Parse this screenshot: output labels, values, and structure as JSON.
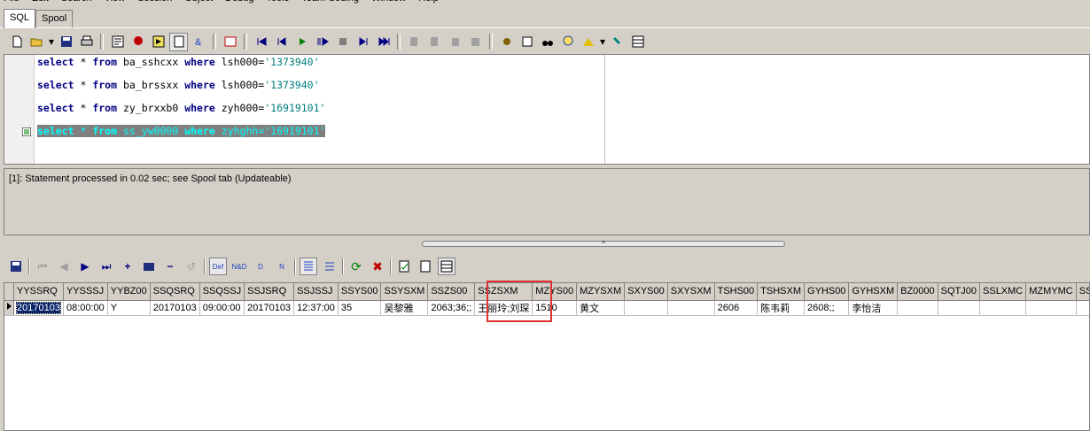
{
  "menubar": {
    "items": [
      "File",
      "Edit",
      "Search",
      "View",
      "Session",
      "Object",
      "Debug",
      "Tools",
      "Team Coding",
      "Window",
      "Help"
    ]
  },
  "tabs": [
    {
      "label": "SQL"
    },
    {
      "label": "Spool"
    }
  ],
  "editor": {
    "lines": [
      {
        "kw1": "select",
        "rest1": " * ",
        "kw2": "from",
        "table": " ba_sshcxx ",
        "kw3": "where",
        "cond": " lsh000=",
        "str": "'1373940'"
      },
      {
        "kw1": "select",
        "rest1": " * ",
        "kw2": "from",
        "table": " ba_brssxx ",
        "kw3": "where",
        "cond": " lsh000=",
        "str": "'1373940'"
      },
      {
        "kw1": "select",
        "rest1": " * ",
        "kw2": "from",
        "table": " zy_brxxb0 ",
        "kw3": "where",
        "cond": " zyh000=",
        "str": "'16919101'"
      },
      {
        "kw1": "select",
        "rest1": " * ",
        "kw2": "from",
        "table": " ss_yw0000 ",
        "kw3": "where",
        "cond": " zyhghh=",
        "str": "'16919101'"
      }
    ]
  },
  "status": {
    "message": "[1]: Statement processed in 0.02 sec; see Spool tab (Updateable)"
  },
  "grid": {
    "columns": [
      "YYSSRQ",
      "YYSSSJ",
      "YYBZ00",
      "SSQSRQ",
      "SSQSSJ",
      "SSJSRQ",
      "SSJSSJ",
      "SSYS00",
      "SSYSXM",
      "SSZS00",
      "SSZSXM",
      "MZYS00",
      "MZYSXM",
      "SXYS00",
      "SXYSXM",
      "TSHS00",
      "TSHSXM",
      "GYHS00",
      "GYHSXM",
      "BZ0000",
      "SQTJ00",
      "SSLXMC",
      "MZMYMC",
      "SSSL"
    ],
    "rows": [
      [
        "20170103",
        "08:00:00",
        "Y",
        "20170103",
        "09:00:00",
        "20170103",
        "12:37:00",
        "35",
        "吴黎雅",
        "2063;36;;",
        "王丽玲;刘琛",
        "1510",
        "黄文",
        "",
        "",
        "2606",
        "陈韦莉",
        "2608;;",
        "李怡洁",
        "",
        "",
        "",
        "",
        ""
      ]
    ]
  },
  "colors": {
    "highlight": "#e03030",
    "keyword": "#000080",
    "string": "#008080",
    "selection_bg": "#808080",
    "selection_fg": "#00ffff"
  }
}
